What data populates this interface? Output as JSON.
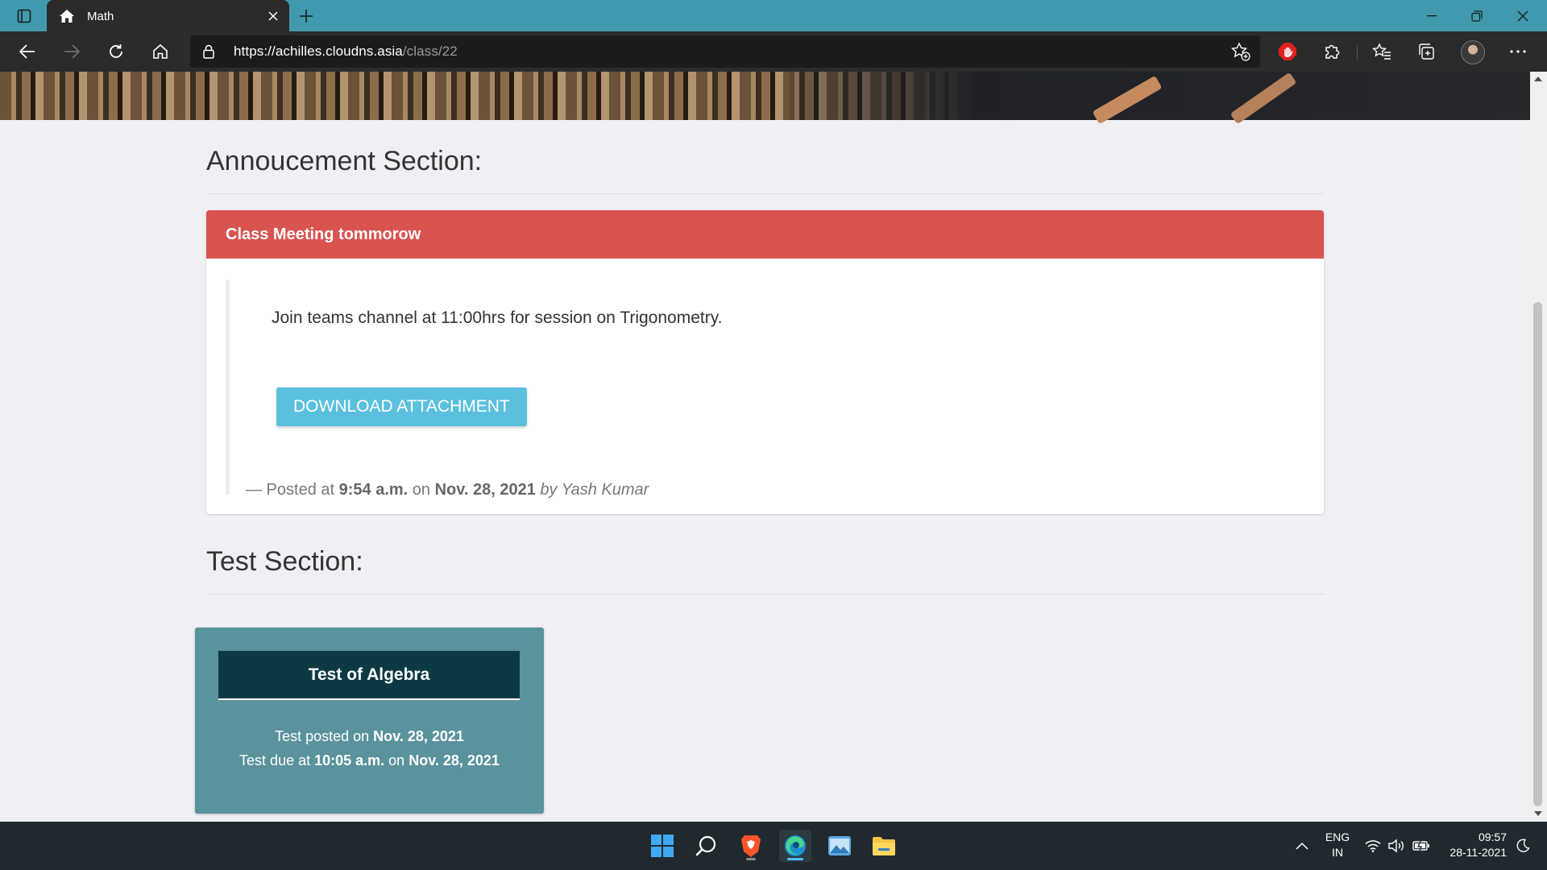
{
  "browser": {
    "tab_title": "Math",
    "url_host": "https://achilles.cloudns.asia",
    "url_path": "/class/22"
  },
  "announcement_section": {
    "title": "Annoucement Section:",
    "announcement": {
      "heading": "Class Meeting tommorow",
      "body": "Join teams channel at 11:00hrs for session on Trigonometry.",
      "download_label": "DOWNLOAD ATTACHMENT",
      "posted_prefix": "— Posted at ",
      "posted_time": "9:54 a.m.",
      "posted_on": " on ",
      "posted_date": "Nov. 28, 2021",
      "posted_by": " by Yash Kumar"
    }
  },
  "test_section": {
    "title": "Test Section:",
    "test": {
      "name": "Test of Algebra",
      "posted_label": "Test posted on ",
      "posted_date": "Nov. 28, 2021",
      "due_label": "Test due at ",
      "due_time": "10:05 a.m.",
      "due_on": " on ",
      "due_date": "Nov. 28, 2021"
    }
  },
  "taskbar": {
    "apps": [
      "start-icon",
      "search-icon",
      "brave-icon",
      "edge-icon",
      "photos-icon",
      "file-explorer-icon"
    ],
    "language_top": "ENG",
    "language_bottom": "IN",
    "time": "09:57",
    "date": "28-11-2021"
  },
  "colors": {
    "titlebar": "#4199ad",
    "announcement_header": "#d9534f",
    "download_button": "#5bc0de",
    "test_card": "#5a939c",
    "test_card_title": "#0c3a43"
  }
}
